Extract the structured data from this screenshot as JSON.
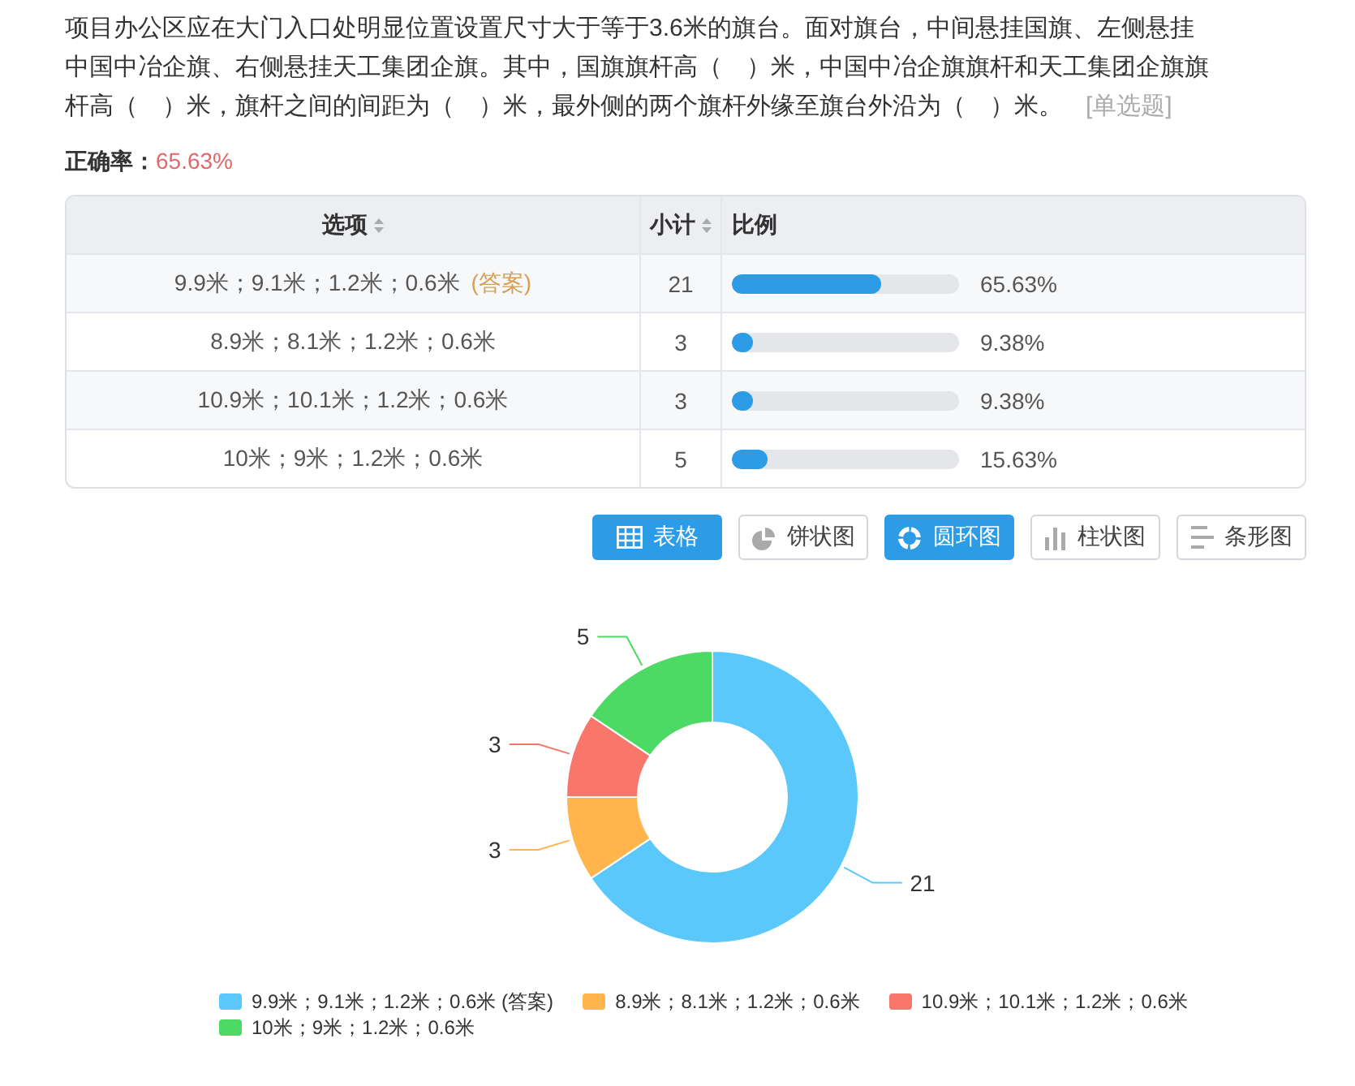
{
  "question": {
    "text": "项目办公区应在大门入口处明显位置设置尺寸大于等于3.6米的旗台。面对旗台，中间悬挂国旗、左侧悬挂中国中冶企旗、右侧悬挂天工集团企旗。其中，国旗旗杆高（　）米，中国中冶企旗旗杆和天工集团企旗旗杆高（　）米，旗杆之间的间距为（　）米，最外侧的两个旗杆外缘至旗台外沿为（　）米。",
    "type_tag": "[单选题]"
  },
  "accuracy": {
    "label": "正确率：",
    "value": "65.63%"
  },
  "table": {
    "columns": [
      {
        "label": "选项",
        "sortable": true
      },
      {
        "label": "小计",
        "sortable": true
      },
      {
        "label": "比例",
        "sortable": false
      }
    ],
    "rows": [
      {
        "option": "9.9米；9.1米；1.2米；0.6米",
        "tag": "(答案)",
        "count": "21",
        "level": 0.6563,
        "percent": "65.63%"
      },
      {
        "option": "8.9米；8.1米；1.2米；0.6米",
        "count": "3",
        "level": 0.0938,
        "percent": "9.38%"
      },
      {
        "option": "10.9米；10.1米；1.2米；0.6米",
        "count": "3",
        "level": 0.0938,
        "percent": "9.38%"
      },
      {
        "option": "10米；9米；1.2米；0.6米",
        "count": "5",
        "level": 0.1563,
        "percent": "15.63%"
      }
    ]
  },
  "view_buttons": [
    {
      "label": "表格",
      "kind": "table",
      "selected": true
    },
    {
      "label": "饼状图",
      "kind": "pie",
      "selected": false
    },
    {
      "label": "圆环图",
      "kind": "donut",
      "selected": true
    },
    {
      "label": "柱状图",
      "kind": "bar",
      "selected": false
    },
    {
      "label": "条形图",
      "kind": "hbar",
      "selected": false
    }
  ],
  "chart": {
    "chart_data": {
      "type": "donut",
      "categories": [
        "9.9米；9.1米；1.2米；0.6米 (答案)",
        "8.9米；8.1米；1.2米；0.6米",
        "10.9米；10.1米；1.2米；0.6米",
        "10米；9米；1.2米；0.6米"
      ],
      "series": [
        {
          "values": [
            21,
            3,
            3,
            5
          ]
        }
      ],
      "colors": [
        "#5ac8fa",
        "#ffb54c",
        "#f8766a",
        "#4cd964"
      ],
      "data_labels": true,
      "legend": "bottom"
    }
  }
}
